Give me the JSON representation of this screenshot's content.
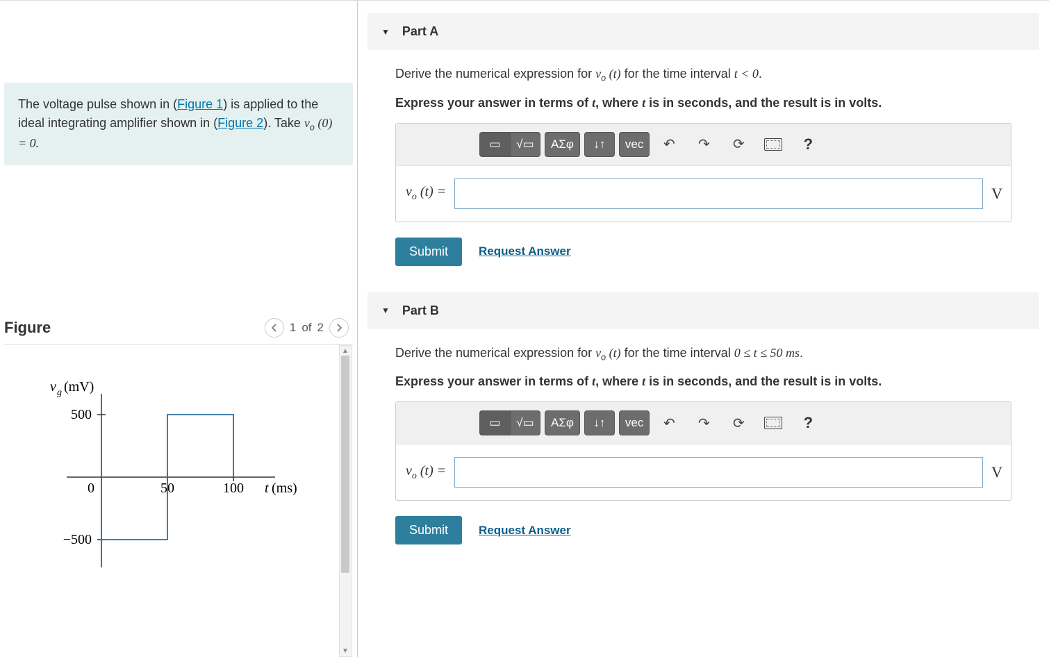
{
  "problem": {
    "intro_pre": "The voltage pulse shown in (",
    "fig1_link": "Figure 1",
    "intro_mid": ") is applied to the ideal integrating amplifier shown in (",
    "fig2_link": "Figure 2",
    "intro_post": "). Take ",
    "v0_expr_lhs": "v",
    "v0_expr_sub": "o",
    "v0_expr_arg": " (0) = 0.",
    "period": "."
  },
  "figure": {
    "title": "Figure",
    "page_current": "1",
    "page_of": "of",
    "page_total": "2"
  },
  "chart_data": {
    "type": "line",
    "title": "",
    "xlabel": "t (ms)",
    "ylabel": "v_g (mV)",
    "xlim": [
      -10,
      120
    ],
    "ylim": [
      -600,
      600
    ],
    "x_ticks": [
      0,
      50,
      100
    ],
    "y_ticks": [
      -500,
      500
    ],
    "y_tick_labels": [
      "−500",
      "500"
    ],
    "origin_label": "0",
    "series": [
      {
        "name": "v_g",
        "points": [
          {
            "x": 0,
            "y": 0
          },
          {
            "x": 0,
            "y": -500
          },
          {
            "x": 50,
            "y": -500
          },
          {
            "x": 50,
            "y": 500
          },
          {
            "x": 100,
            "y": 500
          },
          {
            "x": 100,
            "y": 0
          }
        ]
      }
    ]
  },
  "parts": {
    "A": {
      "title": "Part A",
      "prompt_pre": "Derive the numerical expression for ",
      "v_letter": "v",
      "v_sub": "o",
      "t_arg": " (t)",
      "prompt_mid": " for the time interval ",
      "interval": "t < 0",
      "prompt_end": ".",
      "instruct": "Express your answer in terms of t, where t is in seconds, and the result is in volts.",
      "lhs": "v",
      "lhs_sub": "o",
      "lhs_arg": " (t) = ",
      "unit": "V",
      "submit": "Submit",
      "request": "Request Answer"
    },
    "B": {
      "title": "Part B",
      "prompt_pre": "Derive the numerical expression for ",
      "v_letter": "v",
      "v_sub": "o",
      "t_arg": " (t)",
      "prompt_mid": " for the time interval ",
      "interval": "0 ≤ t ≤ 50 ms",
      "prompt_end": ".",
      "instruct": "Express your answer in terms of t, where t is in seconds, and the result is in volts.",
      "lhs": "v",
      "lhs_sub": "o",
      "lhs_arg": " (t) = ",
      "unit": "V",
      "submit": "Submit",
      "request": "Request Answer"
    }
  },
  "toolbar": {
    "template": "▭",
    "sqrt": "√▭",
    "greek": "ΑΣφ",
    "subscript": "↓↑",
    "vec": "vec",
    "undo": "↶",
    "redo": "↷",
    "reset": "⟳",
    "keyboard": "",
    "help": "?"
  }
}
